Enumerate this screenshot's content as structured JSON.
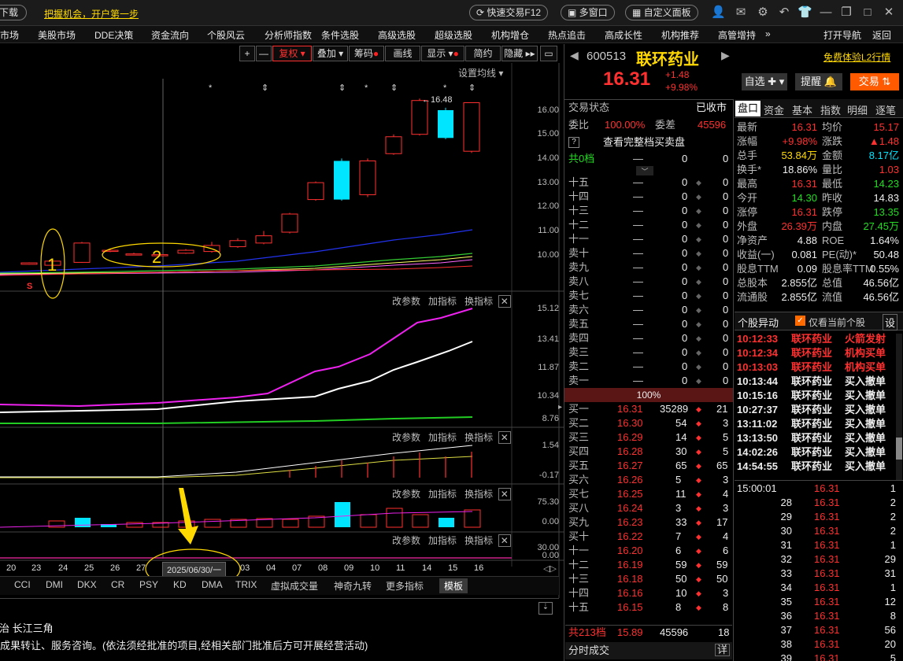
{
  "topbar": {
    "download": "下载",
    "promo": "把握机会，开户第一步",
    "quick_trade": "快速交易F12",
    "multi_window": "多窗口",
    "custom_panel": "自定义面板"
  },
  "menu": [
    "市场",
    "美股市场",
    "DDE决策",
    "资金流向",
    "个股风云",
    "分析师指数",
    "条件选股",
    "高级选股",
    "超级选股",
    "机构增仓",
    "热点追击",
    "高成长性",
    "机构推荐",
    "高管增持",
    "»",
    "打开导航",
    "返回"
  ],
  "chart_toolbar": {
    "plus": "+",
    "minus": "—",
    "fuquan": "复权",
    "overlay": "叠加",
    "chips": "筹码",
    "draw": "画线",
    "display": "显示",
    "simple": "简约",
    "hide": "隐藏"
  },
  "main_chart": {
    "ma_settings": "设置均线",
    "high_label": "16.48",
    "price_axis": [
      "16.00",
      "15.00",
      "14.00",
      "13.00",
      "12.00",
      "11.00",
      "10.00"
    ],
    "annotation_1": "1",
    "annotation_2": "2",
    "s_marker": "S"
  },
  "panel_controls": {
    "params": "改参数",
    "add": "加指标",
    "switch": "换指标"
  },
  "panel2_axis": [
    "15.12",
    "13.41",
    "11.87",
    "10.34",
    "8.76"
  ],
  "panel3_axis": [
    "1.54",
    "-0.17"
  ],
  "panel4_axis": [
    "75.30",
    "0.00"
  ],
  "panel5_axis": [
    "30.00",
    "0.00"
  ],
  "x_dates": [
    "20",
    "23",
    "24",
    "25",
    "26",
    "27",
    "03",
    "04",
    "07",
    "08",
    "09",
    "10",
    "11",
    "14",
    "15",
    "16"
  ],
  "cursor_date": "2025/06/30/一",
  "indicator_tabs": [
    "CCI",
    "DMI",
    "DKX",
    "CR",
    "PSY",
    "KD",
    "DMA",
    "TRIX",
    "虚拟成交量",
    "神奇九转",
    "更多指标",
    "模板"
  ],
  "info_text": {
    "line1": "防治  长江三角",
    "line2": "成果转让、服务咨询。(依法须经批准的项目,经相关部门批准后方可开展经营活动)"
  },
  "stock": {
    "code": "600513",
    "name": "联环药业",
    "price": "16.31",
    "change": "+1.48",
    "change_pct": "+9.98%",
    "trial": "免费体验L2行情",
    "btn_watch": "自选",
    "btn_alert": "提醒",
    "btn_trade": "交易"
  },
  "trade_status": {
    "label": "交易状态",
    "value": "已收市"
  },
  "weibi": {
    "label1": "委比",
    "val1": "100.00%",
    "label2": "委差",
    "val2": "45596"
  },
  "view_full": "查看完整档买卖盘",
  "book_header": {
    "label": "共0档",
    "dash": "—",
    "v1": "0",
    "v2": "0"
  },
  "sell_levels": [
    {
      "name": "十五",
      "price": "—",
      "vol": "0",
      "n": "0"
    },
    {
      "name": "十四",
      "price": "—",
      "vol": "0",
      "n": "0"
    },
    {
      "name": "十三",
      "price": "—",
      "vol": "0",
      "n": "0"
    },
    {
      "name": "十二",
      "price": "—",
      "vol": "0",
      "n": "0"
    },
    {
      "name": "十一",
      "price": "—",
      "vol": "0",
      "n": "0"
    },
    {
      "name": "卖十",
      "price": "—",
      "vol": "0",
      "n": "0"
    },
    {
      "name": "卖九",
      "price": "—",
      "vol": "0",
      "n": "0"
    },
    {
      "name": "卖八",
      "price": "—",
      "vol": "0",
      "n": "0"
    },
    {
      "name": "卖七",
      "price": "—",
      "vol": "0",
      "n": "0"
    },
    {
      "name": "卖六",
      "price": "—",
      "vol": "0",
      "n": "0"
    },
    {
      "name": "卖五",
      "price": "—",
      "vol": "0",
      "n": "0"
    },
    {
      "name": "卖四",
      "price": "—",
      "vol": "0",
      "n": "0"
    },
    {
      "name": "卖三",
      "price": "—",
      "vol": "0",
      "n": "0"
    },
    {
      "name": "卖二",
      "price": "—",
      "vol": "0",
      "n": "0"
    },
    {
      "name": "卖一",
      "price": "—",
      "vol": "0",
      "n": "0"
    }
  ],
  "book_ratio": "100%",
  "buy_levels": [
    {
      "name": "买一",
      "price": "16.31",
      "vol": "35289",
      "n": "21"
    },
    {
      "name": "买二",
      "price": "16.30",
      "vol": "54",
      "n": "3"
    },
    {
      "name": "买三",
      "price": "16.29",
      "vol": "14",
      "n": "5"
    },
    {
      "name": "买四",
      "price": "16.28",
      "vol": "30",
      "n": "5"
    },
    {
      "name": "买五",
      "price": "16.27",
      "vol": "65",
      "n": "65"
    },
    {
      "name": "买六",
      "price": "16.26",
      "vol": "5",
      "n": "3"
    },
    {
      "name": "买七",
      "price": "16.25",
      "vol": "11",
      "n": "4"
    },
    {
      "name": "买八",
      "price": "16.24",
      "vol": "3",
      "n": "3"
    },
    {
      "name": "买九",
      "price": "16.23",
      "vol": "33",
      "n": "17"
    },
    {
      "name": "买十",
      "price": "16.22",
      "vol": "7",
      "n": "4"
    },
    {
      "name": "十一",
      "price": "16.20",
      "vol": "6",
      "n": "6"
    },
    {
      "name": "十二",
      "price": "16.19",
      "vol": "59",
      "n": "59"
    },
    {
      "name": "十三",
      "price": "16.18",
      "vol": "50",
      "n": "50"
    },
    {
      "name": "十四",
      "price": "16.16",
      "vol": "10",
      "n": "3"
    },
    {
      "name": "十五",
      "price": "16.15",
      "vol": "8",
      "n": "8"
    }
  ],
  "book_footer": {
    "label": "共213档",
    "price": "15.89",
    "vol": "45596",
    "n": "18"
  },
  "fenshi": {
    "label": "分时成交",
    "detail": "详"
  },
  "tabs": [
    "盘口",
    "资金",
    "基本",
    "指数",
    "明细",
    "逐笔"
  ],
  "quote_rows": [
    {
      "l1": "最新",
      "v1": "16.31",
      "c1": "red",
      "l2": "均价",
      "v2": "15.17",
      "c2": "red"
    },
    {
      "l1": "涨幅",
      "v1": "+9.98%",
      "c1": "red",
      "l2": "涨跌",
      "v2": "▲1.48",
      "c2": "red"
    },
    {
      "l1": "总手",
      "v1": "53.84万",
      "c1": "yellow",
      "l2": "金额",
      "v2": "8.17亿",
      "c2": "cyan"
    },
    {
      "l1": "换手*",
      "v1": "18.86%",
      "c1": "white",
      "l2": "量比",
      "v2": "1.03",
      "c2": "red"
    },
    {
      "l1": "最高",
      "v1": "16.31",
      "c1": "red",
      "l2": "最低",
      "v2": "14.23",
      "c2": "green"
    },
    {
      "l1": "今开",
      "v1": "14.30",
      "c1": "green",
      "l2": "昨收",
      "v2": "14.83",
      "c2": "white"
    },
    {
      "l1": "涨停",
      "v1": "16.31",
      "c1": "red",
      "l2": "跌停",
      "v2": "13.35",
      "c2": "green"
    },
    {
      "l1": "外盘",
      "v1": "26.39万",
      "c1": "red",
      "l2": "内盘",
      "v2": "27.45万",
      "c2": "green"
    },
    {
      "l1": "净资产",
      "v1": "4.88",
      "c1": "white",
      "l2": "ROE",
      "v2": "1.64%",
      "c2": "white"
    },
    {
      "l1": "收益(一)",
      "v1": "0.081",
      "c1": "white",
      "l2": "PE(动)*",
      "v2": "50.48",
      "c2": "white"
    },
    {
      "l1": "股息TTM",
      "v1": "0.09",
      "c1": "white",
      "l2": "股息率TTM",
      "v2": "0.55%",
      "c2": "white"
    },
    {
      "l1": "总股本",
      "v1": "2.855亿",
      "c1": "white",
      "l2": "总值",
      "v2": "46.56亿",
      "c2": "white"
    },
    {
      "l1": "流通股",
      "v1": "2.855亿",
      "c1": "white",
      "l2": "流值",
      "v2": "46.56亿",
      "c2": "white"
    }
  ],
  "events_header": {
    "title": "个股异动",
    "checkbox": "仅看当前个股",
    "settings": "设"
  },
  "events": [
    {
      "time": "10:12:33",
      "name": "联环药业",
      "type": "火箭发射",
      "color": "red"
    },
    {
      "time": "10:12:34",
      "name": "联环药业",
      "type": "机构买单",
      "color": "red"
    },
    {
      "time": "10:13:03",
      "name": "联环药业",
      "type": "机构买单",
      "color": "red"
    },
    {
      "time": "10:13:44",
      "name": "联环药业",
      "type": "买入撤单",
      "color": "white"
    },
    {
      "time": "10:15:16",
      "name": "联环药业",
      "type": "买入撤单",
      "color": "white"
    },
    {
      "time": "10:27:37",
      "name": "联环药业",
      "type": "买入撤单",
      "color": "white"
    },
    {
      "time": "13:11:02",
      "name": "联环药业",
      "type": "买入撤单",
      "color": "white"
    },
    {
      "time": "13:13:50",
      "name": "联环药业",
      "type": "买入撤单",
      "color": "white"
    },
    {
      "time": "14:02:26",
      "name": "联环药业",
      "type": "买入撤单",
      "color": "white"
    },
    {
      "time": "14:54:55",
      "name": "联环药业",
      "type": "买入撤单",
      "color": "white"
    }
  ],
  "ticks": [
    {
      "t": "15:00:01",
      "p": "16.31",
      "v": "1"
    },
    {
      "t": "28",
      "p": "16.31",
      "v": "2"
    },
    {
      "t": "29",
      "p": "16.31",
      "v": "2"
    },
    {
      "t": "30",
      "p": "16.31",
      "v": "2"
    },
    {
      "t": "31",
      "p": "16.31",
      "v": "1"
    },
    {
      "t": "32",
      "p": "16.31",
      "v": "29"
    },
    {
      "t": "33",
      "p": "16.31",
      "v": "31"
    },
    {
      "t": "34",
      "p": "16.31",
      "v": "1"
    },
    {
      "t": "35",
      "p": "16.31",
      "v": "12"
    },
    {
      "t": "36",
      "p": "16.31",
      "v": "8"
    },
    {
      "t": "37",
      "p": "16.31",
      "v": "56"
    },
    {
      "t": "38",
      "p": "16.31",
      "v": "20"
    },
    {
      "t": "39",
      "p": "16.31",
      "v": "5"
    }
  ],
  "candles": [
    {
      "o": 9.62,
      "c": 9.68,
      "h": 9.7,
      "l": 9.6
    },
    {
      "o": 9.58,
      "c": 9.75,
      "h": 9.78,
      "l": 9.55
    },
    {
      "o": 9.7,
      "c": 10.5,
      "h": 10.55,
      "l": 9.68
    },
    {
      "o": 10.2,
      "c": 10.2,
      "h": 10.28,
      "l": 10.12
    },
    {
      "o": 10.05,
      "c": 10.05,
      "h": 10.1,
      "l": 10.0
    },
    {
      "o": 10.02,
      "c": 10.02,
      "h": 10.08,
      "l": 9.98
    },
    {
      "o": 10.08,
      "c": 10.2,
      "h": 10.25,
      "l": 10.05
    },
    {
      "o": 10.15,
      "c": 10.4,
      "h": 10.55,
      "l": 10.1
    },
    {
      "o": 10.35,
      "c": 10.6,
      "h": 10.7,
      "l": 10.3
    },
    {
      "o": 10.5,
      "c": 10.8,
      "h": 11.0,
      "l": 10.45
    },
    {
      "o": 10.95,
      "c": 11.7,
      "h": 11.75,
      "l": 10.9
    },
    {
      "o": 12.3,
      "c": 13.0,
      "h": 13.05,
      "l": 12.25
    },
    {
      "o": 13.9,
      "c": 12.3,
      "h": 14.0,
      "l": 12.25
    },
    {
      "o": 12.5,
      "c": 13.9,
      "h": 14.0,
      "l": 12.4
    },
    {
      "o": 14.2,
      "c": 14.9,
      "h": 15.0,
      "l": 14.15
    },
    {
      "o": 15.0,
      "c": 16.4,
      "h": 16.48,
      "l": 14.95
    },
    {
      "o": 16.0,
      "c": 14.85,
      "h": 16.1,
      "l": 14.8
    },
    {
      "o": 14.3,
      "c": 16.31,
      "h": 16.31,
      "l": 14.23
    }
  ]
}
